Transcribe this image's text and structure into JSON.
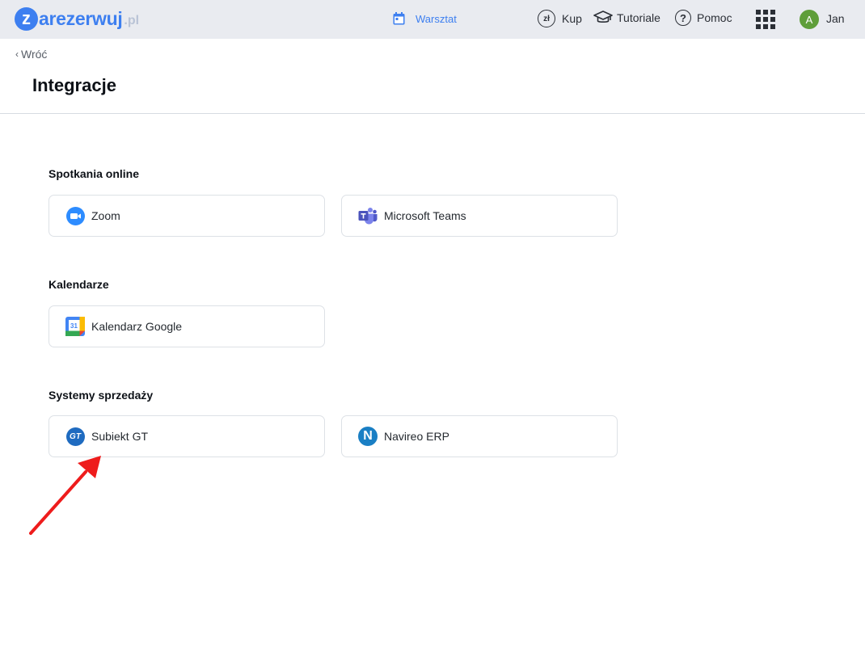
{
  "header": {
    "logo_letter": "z",
    "logo_text": "arezerwuj",
    "logo_tld": ".pl",
    "center_link": "Warsztat",
    "kup_icon_text": "zł",
    "kup_label": "Kup",
    "tutoriale_label": "Tutoriale",
    "pomoc_icon_text": "?",
    "pomoc_label": "Pomoc",
    "avatar_initial": "A",
    "user_name": "Jan"
  },
  "page": {
    "back_label": "Wróć",
    "title": "Integracje"
  },
  "sections": [
    {
      "title": "Spotkania online",
      "items": [
        {
          "label": "Zoom",
          "icon": "zoom-icon"
        },
        {
          "label": "Microsoft Teams",
          "icon": "microsoft-teams-icon"
        }
      ]
    },
    {
      "title": "Kalendarze",
      "items": [
        {
          "label": "Kalendarz Google",
          "icon": "google-calendar-icon",
          "icon_text": "31"
        }
      ]
    },
    {
      "title": "Systemy sprzedaży",
      "items": [
        {
          "label": "Subiekt GT",
          "icon": "subiekt-gt-icon",
          "icon_text": "GT"
        },
        {
          "label": "Navireo ERP",
          "icon": "navireo-icon",
          "icon_text": "N"
        }
      ]
    }
  ],
  "colors": {
    "accent": "#3d7ff0",
    "topbar_bg": "#e9ebf0",
    "annotation_arrow": "#ee1c1c",
    "avatar_bg": "#5f9e3a"
  }
}
